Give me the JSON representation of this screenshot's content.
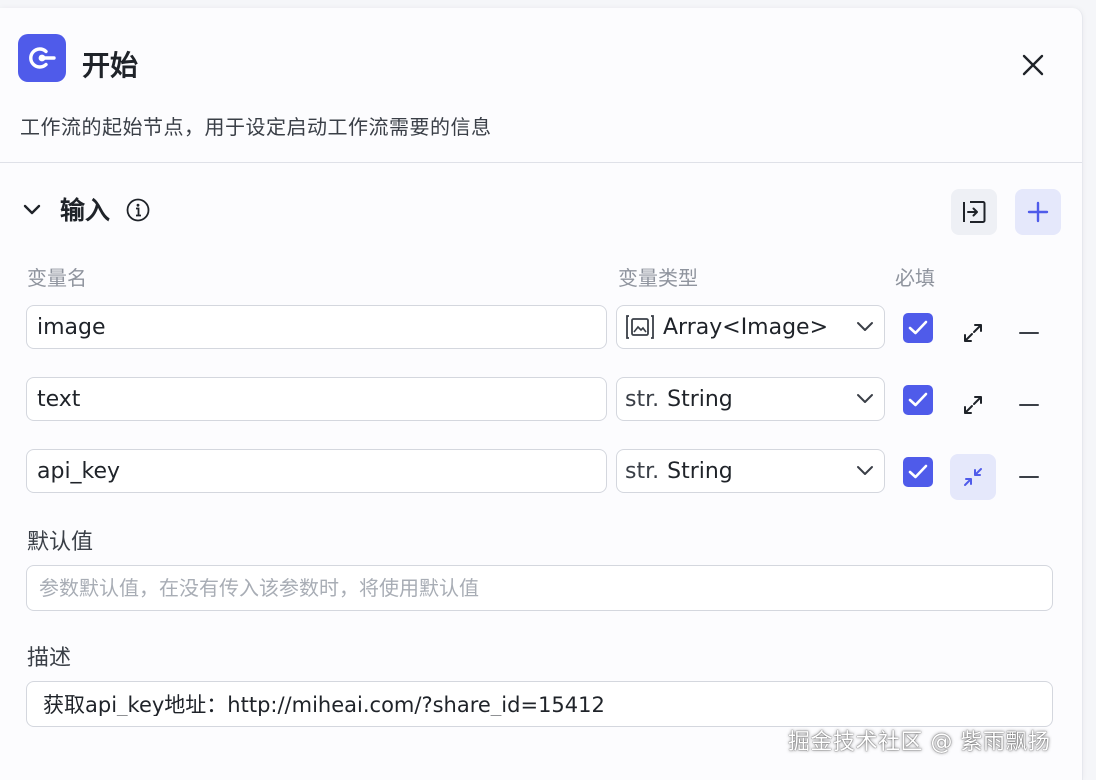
{
  "header": {
    "title": "开始",
    "subtitle": "工作流的起始节点，用于设定启动工作流需要的信息",
    "icon": "start-node-icon",
    "accent_color": "#4f5bea"
  },
  "section": {
    "title": "输入",
    "info_icon": "info-icon",
    "import_icon": "import-icon",
    "add_icon": "plus-icon"
  },
  "columns": {
    "name": "变量名",
    "type": "变量类型",
    "required": "必填"
  },
  "variables": [
    {
      "name": "image",
      "type_prefix": "",
      "type_icon": "image-icon",
      "type": "Array<Image>",
      "required": true,
      "expand_state": "expand"
    },
    {
      "name": "text",
      "type_prefix": "str.",
      "type_icon": "",
      "type": "String",
      "required": true,
      "expand_state": "expand"
    },
    {
      "name": "api_key",
      "type_prefix": "str.",
      "type_icon": "",
      "type": "String",
      "required": true,
      "expand_state": "collapse"
    }
  ],
  "default_value": {
    "label": "默认值",
    "placeholder": "参数默认值，在没有传入该参数时，将使用默认值",
    "value": ""
  },
  "description": {
    "label": "描述",
    "value": "获取api_key地址：http://miheai.com/?share_id=15412"
  },
  "watermark": "掘金技术社区 @ 紫雨飘扬"
}
